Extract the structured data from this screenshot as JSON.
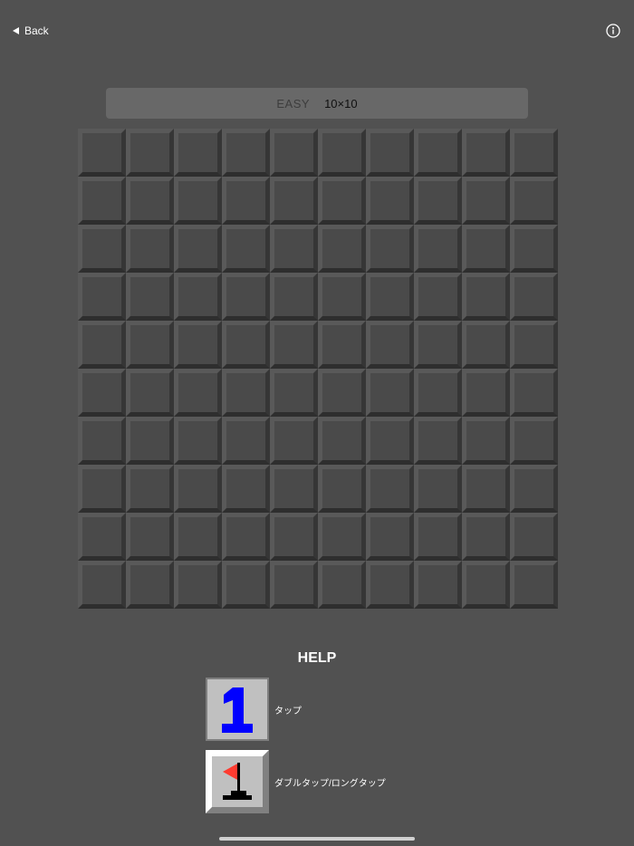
{
  "nav": {
    "back_label": "Back",
    "back_icon": "left-triangle-icon",
    "info_icon": "info-circle-icon"
  },
  "level": {
    "name": "EASY",
    "size": "10×10"
  },
  "board": {
    "rows": 10,
    "cols": 10,
    "cell_state": "unrevealed"
  },
  "help": {
    "title": "HELP",
    "items": [
      {
        "tile": "number",
        "number": "1",
        "number_color": "#0000ff",
        "label": "タップ"
      },
      {
        "tile": "flag",
        "flag_color": "#ff3b30",
        "label": "ダブルタップ/ロングタップ"
      }
    ]
  },
  "colors": {
    "background": "#515151",
    "cell_face": "#4a4a4a",
    "level_bar": "#686868",
    "help_tile": "#c0c0c0"
  }
}
